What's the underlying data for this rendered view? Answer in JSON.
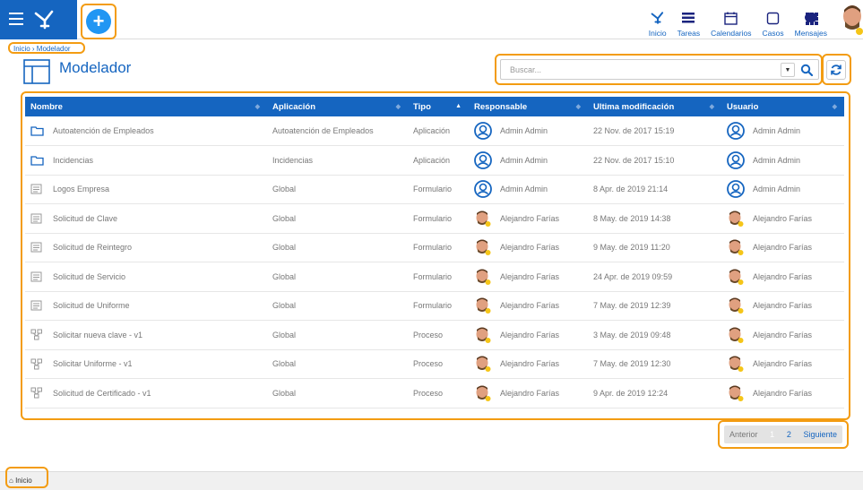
{
  "topbar": {
    "menu_icon": "hamburger-icon",
    "logo_icon": "app-logo-icon",
    "add_icon": "plus-icon",
    "nav": [
      {
        "label": "Inicio",
        "icon": "logo-icon"
      },
      {
        "label": "Tareas",
        "icon": "tasks-icon"
      },
      {
        "label": "Calendarios",
        "icon": "calendar-icon"
      },
      {
        "label": "Casos",
        "icon": "square-icon"
      },
      {
        "label": "Mensajes",
        "icon": "chat-bubble-icon"
      }
    ],
    "apps_icon": "apps-grid-icon",
    "accent": "#1565c0"
  },
  "breadcrumb": "Inicio › Modelador",
  "page": {
    "title": "Modelador",
    "icon": "layout-icon"
  },
  "search": {
    "placeholder": "Buscar..."
  },
  "table": {
    "columns": [
      "Nombre",
      "Aplicación",
      "Tipo",
      "Responsable",
      "Ultima modificación",
      "Usuario"
    ],
    "rows": [
      {
        "name": "Autoatención de Empleados",
        "app": "Autoatención de Empleados",
        "type": "Aplicación",
        "owner": "Admin Admin",
        "modified": "22 Nov. de 2017 15:19",
        "user": "Admin Admin",
        "icon": "folder"
      },
      {
        "name": "Incidencias",
        "app": "Incidencias",
        "type": "Aplicación",
        "owner": "Admin Admin",
        "modified": "22 Nov. de 2017 15:10",
        "user": "Admin Admin",
        "icon": "folder"
      },
      {
        "name": "Logos Empresa",
        "app": "Global",
        "type": "Formulario",
        "owner": "Admin Admin",
        "modified": "8 Apr. de 2019 21:14",
        "user": "Admin Admin",
        "icon": "form"
      },
      {
        "name": "Solicitud de Clave",
        "app": "Global",
        "type": "Formulario",
        "owner": "Alejandro Farías",
        "modified": "8 May. de 2019 14:38",
        "user": "Alejandro Farías",
        "icon": "form"
      },
      {
        "name": "Solicitud de Reintegro",
        "app": "Global",
        "type": "Formulario",
        "owner": "Alejandro Farías",
        "modified": "9 May. de 2019 11:20",
        "user": "Alejandro Farías",
        "icon": "form"
      },
      {
        "name": "Solicitud de Servicio",
        "app": "Global",
        "type": "Formulario",
        "owner": "Alejandro Farías",
        "modified": "24 Apr. de 2019 09:59",
        "user": "Alejandro Farías",
        "icon": "form"
      },
      {
        "name": "Solicitud de Uniforme",
        "app": "Global",
        "type": "Formulario",
        "owner": "Alejandro Farías",
        "modified": "7 May. de 2019 12:39",
        "user": "Alejandro Farías",
        "icon": "form"
      },
      {
        "name": "Solicitar nueva clave - v1",
        "app": "Global",
        "type": "Proceso",
        "owner": "Alejandro Farías",
        "modified": "3 May. de 2019 09:48",
        "user": "Alejandro Farías",
        "icon": "process"
      },
      {
        "name": "Solicitar Uniforme - v1",
        "app": "Global",
        "type": "Proceso",
        "owner": "Alejandro Farías",
        "modified": "7 May. de 2019 12:30",
        "user": "Alejandro Farías",
        "icon": "process"
      },
      {
        "name": "Solicitud de Certificado - v1",
        "app": "Global",
        "type": "Proceso",
        "owner": "Alejandro Farías",
        "modified": "9 Apr. de 2019 12:24",
        "user": "Alejandro Farías",
        "icon": "process"
      }
    ]
  },
  "pager": {
    "prev": "Anterior",
    "current": "1",
    "page2": "2",
    "next": "Siguiente"
  },
  "footer": {
    "home": "Inicio",
    "home_icon": "home-icon"
  }
}
